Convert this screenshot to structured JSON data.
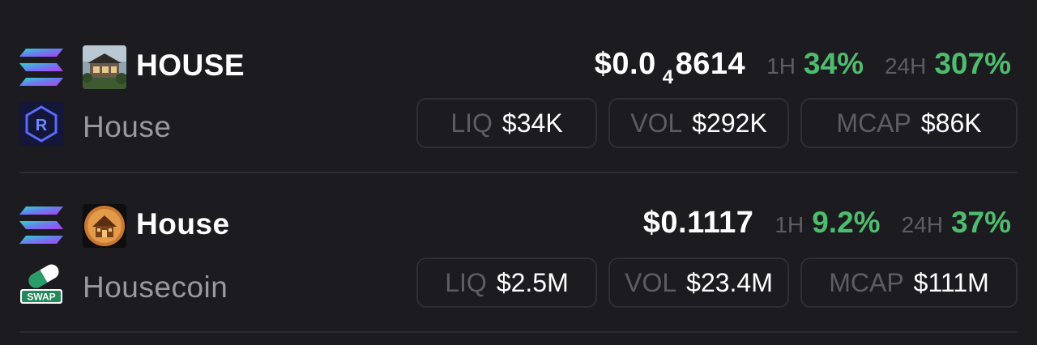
{
  "colors": {
    "background": "#1c1b20",
    "positive": "#4ebd6e",
    "muted": "#5e5d65",
    "name": "#9a99a2",
    "border": "#2f2e35"
  },
  "tokens": [
    {
      "chain_icon": "solana-icon",
      "token_icon": "house-photo-icon",
      "dex_icon": "raydium-icon",
      "symbol": "HOUSE",
      "name": "House",
      "price_prefix": "$0.0",
      "price_subscript": "4",
      "price_suffix": "8614",
      "change_1h_label": "1H",
      "change_1h": "34%",
      "change_24h_label": "24H",
      "change_24h": "307%",
      "liq_label": "LIQ",
      "liq": "$34K",
      "vol_label": "VOL",
      "vol": "$292K",
      "mcap_label": "MCAP",
      "mcap": "$86K"
    },
    {
      "chain_icon": "solana-icon",
      "token_icon": "house-coin-icon",
      "dex_icon": "swap-icon",
      "dex_badge_text": "SWAP",
      "symbol": "House",
      "name": "Housecoin",
      "price": "$0.1117",
      "change_1h_label": "1H",
      "change_1h": "9.2%",
      "change_24h_label": "24H",
      "change_24h": "37%",
      "liq_label": "LIQ",
      "liq": "$2.5M",
      "vol_label": "VOL",
      "vol": "$23.4M",
      "mcap_label": "MCAP",
      "mcap": "$111M"
    }
  ]
}
